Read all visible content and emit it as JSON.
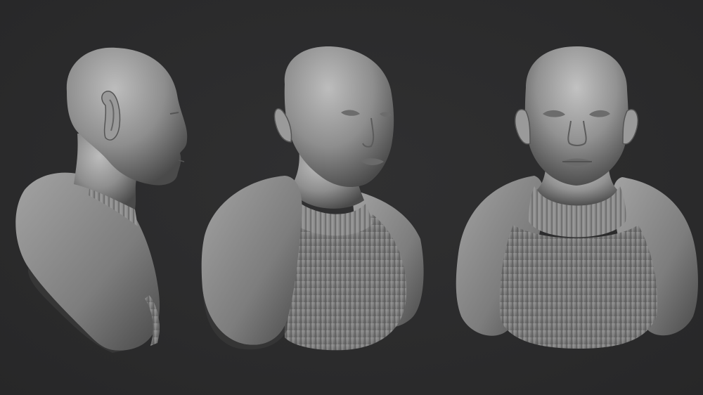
{
  "scene": {
    "background_color": "#2b2b2c",
    "clay_color": "#8c8c8c",
    "renders": [
      {
        "id": "bust-side-view",
        "view": "right profile"
      },
      {
        "id": "bust-three-quarter-view",
        "view": "three-quarter"
      },
      {
        "id": "bust-front-view",
        "view": "front"
      }
    ]
  }
}
